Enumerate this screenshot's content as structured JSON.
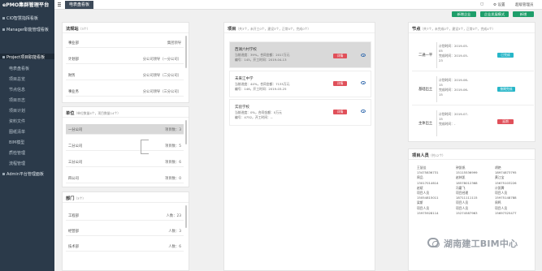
{
  "app": {
    "brand": "ePMO集群管理平台"
  },
  "sidebar": {
    "items": [
      {
        "label": "CIO智慧指挥看板",
        "kind": "top"
      },
      {
        "label": "Manager职能管理看板",
        "kind": "top"
      },
      {
        "label": "Project项目职能看板",
        "kind": "top",
        "active": true
      },
      {
        "label": "电表盘看板",
        "kind": "sub"
      },
      {
        "label": "项目总览",
        "kind": "sub"
      },
      {
        "label": "节点信息",
        "kind": "sub"
      },
      {
        "label": "项目日志",
        "kind": "sub"
      },
      {
        "label": "项目计划",
        "kind": "sub"
      },
      {
        "label": "资料文件",
        "kind": "sub"
      },
      {
        "label": "图纸清单",
        "kind": "sub"
      },
      {
        "label": "BIM模型",
        "kind": "sub"
      },
      {
        "label": "质检管理",
        "kind": "sub"
      },
      {
        "label": "流程管理",
        "kind": "sub"
      },
      {
        "label": "Admin平台管理面板",
        "kind": "top"
      }
    ]
  },
  "topbar": {
    "tab_label": "电表盘看板",
    "right_items": [
      "▢",
      "⚙ 设置",
      "超级管理员"
    ]
  },
  "toolbar": {
    "buttons": [
      "新增企业",
      "企业发展模式",
      "新增"
    ]
  },
  "panels": {
    "company": {
      "title": "法规站",
      "count": "（3个）",
      "rows": [
        {
          "name": "事业部",
          "value": "集团领导"
        },
        {
          "name": "计划部",
          "value": "分公司领导（一分公司）"
        },
        {
          "name": "财务",
          "value": "分公司领导（二分公司）"
        },
        {
          "name": "事业务",
          "value": "分公司领导（三分公司）"
        }
      ]
    },
    "units": {
      "title": "单位",
      "count": "（单位数量4个，项目数量14个）",
      "rows": [
        {
          "name": "一分公司",
          "value": "项目数：3"
        },
        {
          "name": "二分公司",
          "value": "项目数：5"
        },
        {
          "name": "三分公司",
          "value": "项目数：6"
        },
        {
          "name": "四公司",
          "value": "项目数：0"
        }
      ]
    },
    "departments": {
      "title": "部门",
      "count": "（3个）",
      "rows": [
        {
          "name": "工程部",
          "value": "人数：23"
        },
        {
          "name": "经营部",
          "value": "人数：3"
        },
        {
          "name": "技术部",
          "value": "人数：6"
        }
      ]
    },
    "projects": {
      "title": "项目",
      "count": "（共3个，未开工0个，建设3个，正常0个，完成0个）",
      "cards": [
        {
          "name": "西湖六村学校",
          "line1": "当前进度：39%，合同金额：2017万元",
          "line2": "编号：145，开工时间：2019-04-13",
          "btn": "详情"
        },
        {
          "name": "未来江中学",
          "line1": "当前进度：44%，合同金额：7135万元",
          "line2": "编号：146，开工时间：2019-03-25",
          "btn": "详情"
        },
        {
          "name": "实验学校",
          "line1": "当前进度：0%，合同金额：0万元",
          "line2": "编号：4752，开工时间：--",
          "btn": "详情"
        }
      ]
    },
    "nodes": {
      "title": "节点",
      "count": "（共7个，未完成0个，建设3个，正常0个，完成4个）",
      "items": [
        {
          "name": "二通一平",
          "d1": "计划时间：2019-05-",
          "d2": "05",
          "d3": "完成时间：2019-05-",
          "d4": "23",
          "btn": "已完成",
          "btn_color": "teal"
        },
        {
          "name": "基础出土",
          "d1": "计划时间：2019-06-",
          "d2": "15",
          "d3": "完成时间：2019-06-",
          "d4": "15",
          "btn": "按期完成",
          "btn_color": "teal"
        },
        {
          "name": "主体出土",
          "d1": "计划时间：2019-07-",
          "d2": "15",
          "d3": "完成时间：-",
          "d4": "",
          "btn": "延期",
          "btn_color": "red"
        }
      ]
    },
    "people": {
      "title": "项目人员",
      "count": "（共12个）",
      "grid": [
        [
          "王慧佳",
          "钟凯帆",
          "胡艳"
        ],
        [
          "13475836731",
          "15115536999",
          "18974873795"
        ],
        [
          "周品",
          "赵林凯",
          "黄江宝"
        ],
        [
          "13017014614",
          "18578012368",
          "15675103226"
        ],
        [
          "赵斌",
          "冯霍飞",
          "计凯腾"
        ],
        [
          "项目人员",
          "项目经理",
          "项目人员"
        ],
        [
          "15054815011",
          "18711111115",
          "15975148788"
        ],
        [
          "梁斯",
          "项目人员",
          "周鸣"
        ],
        [
          "项目人员",
          "项目人员",
          "项目人员"
        ],
        [
          "15975928114",
          "15274587963",
          "15697325477"
        ]
      ]
    }
  },
  "watermark": {
    "text": "湖南建工BIM中心"
  },
  "colors": {
    "sidebar": "#2b3a4a",
    "green": "#1e9e6a",
    "red": "#e0505a",
    "teal": "#27b6c8"
  }
}
